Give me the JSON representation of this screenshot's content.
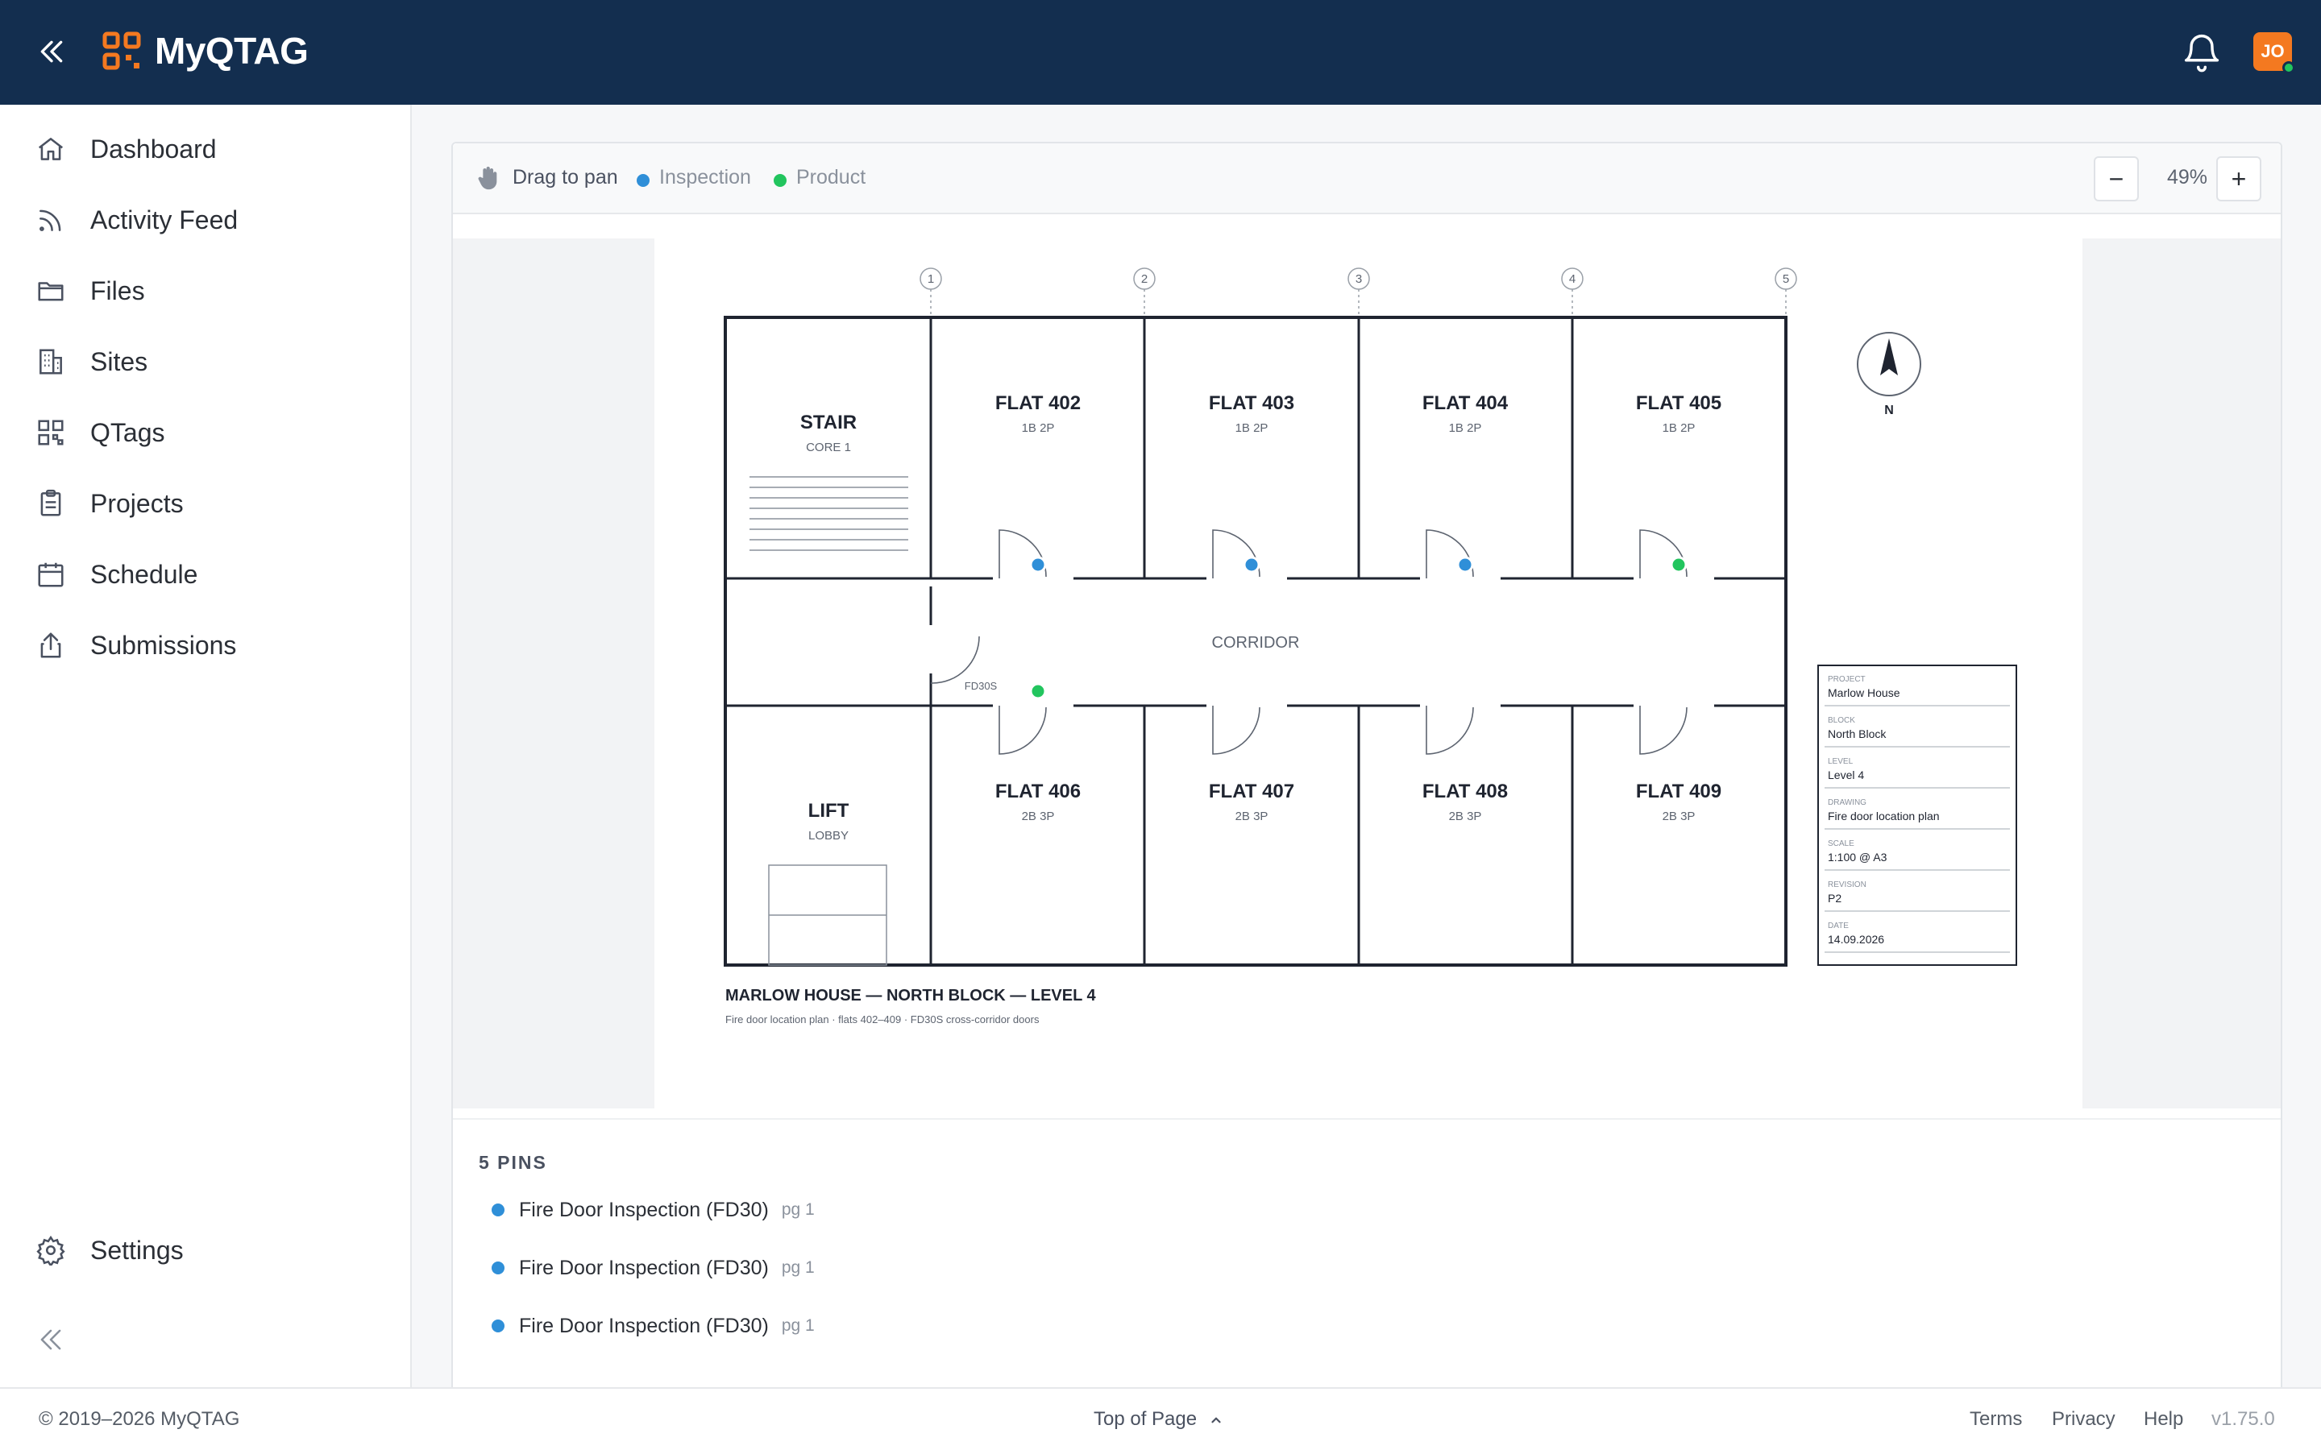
{
  "app": {
    "name": "MyQTAG",
    "user_initials": "JO",
    "accent": "#f47920",
    "header_bg": "#132e4f"
  },
  "sidebar": {
    "items": [
      {
        "label": "Dashboard",
        "icon": "home-icon"
      },
      {
        "label": "Activity Feed",
        "icon": "rss-icon"
      },
      {
        "label": "Files",
        "icon": "folder-icon"
      },
      {
        "label": "Sites",
        "icon": "building-icon"
      },
      {
        "label": "QTags",
        "icon": "qr-code-icon"
      },
      {
        "label": "Projects",
        "icon": "clipboard-icon"
      },
      {
        "label": "Schedule",
        "icon": "calendar-icon"
      },
      {
        "label": "Submissions",
        "icon": "upload-icon"
      }
    ],
    "settings": "Settings"
  },
  "viewer": {
    "drag_hint": "Drag to pan",
    "legend": [
      {
        "label": "Inspection",
        "color": "#2f8fd8"
      },
      {
        "label": "Product",
        "color": "#22c55e"
      }
    ],
    "zoom": "49%",
    "zoom_out": "−",
    "zoom_in": "+"
  },
  "plan": {
    "grid_labels": [
      "1",
      "2",
      "3",
      "4",
      "5"
    ],
    "stair": {
      "title": "STAIR",
      "sub": "CORE 1"
    },
    "lift": {
      "title": "LIFT",
      "sub": "LOBBY"
    },
    "corridor": "CORRIDOR",
    "door_tag": "FD30S",
    "north": "N",
    "top_flats": [
      {
        "name": "FLAT 402",
        "type": "1B 2P"
      },
      {
        "name": "FLAT 403",
        "type": "1B 2P"
      },
      {
        "name": "FLAT 404",
        "type": "1B 2P"
      },
      {
        "name": "FLAT 405",
        "type": "1B 2P"
      }
    ],
    "bottom_flats": [
      {
        "name": "FLAT 406",
        "type": "2B 3P"
      },
      {
        "name": "FLAT 407",
        "type": "2B 3P"
      },
      {
        "name": "FLAT 408",
        "type": "2B 3P"
      },
      {
        "name": "FLAT 409",
        "type": "2B 3P"
      }
    ],
    "title": "MARLOW HOUSE — NORTH BLOCK — LEVEL 4",
    "subtitle": "Fire door location plan · flats 402–409 · FD30S cross-corridor doors",
    "title_block": [
      {
        "label": "PROJECT",
        "value": "Marlow House"
      },
      {
        "label": "BLOCK",
        "value": "North Block"
      },
      {
        "label": "LEVEL",
        "value": "Level 4"
      },
      {
        "label": "DRAWING",
        "value": "Fire door location plan"
      },
      {
        "label": "SCALE",
        "value": "1:100 @ A3"
      },
      {
        "label": "REVISION",
        "value": "P2"
      },
      {
        "label": "DATE",
        "value": "14.09.2026"
      }
    ]
  },
  "pins": {
    "count_label": "5 PINS",
    "items": [
      {
        "title": "Fire Door Inspection (FD30)",
        "page": "pg 1",
        "color": "#2f8fd8"
      },
      {
        "title": "Fire Door Inspection (FD30)",
        "page": "pg 1",
        "color": "#2f8fd8"
      },
      {
        "title": "Fire Door Inspection (FD30)",
        "page": "pg 1",
        "color": "#2f8fd8"
      }
    ]
  },
  "footer": {
    "copyright": "© 2019–2026 MyQTAG",
    "top_of_page": "Top of Page",
    "links": [
      "Terms",
      "Privacy",
      "Help"
    ],
    "version": "v1.75.0"
  }
}
